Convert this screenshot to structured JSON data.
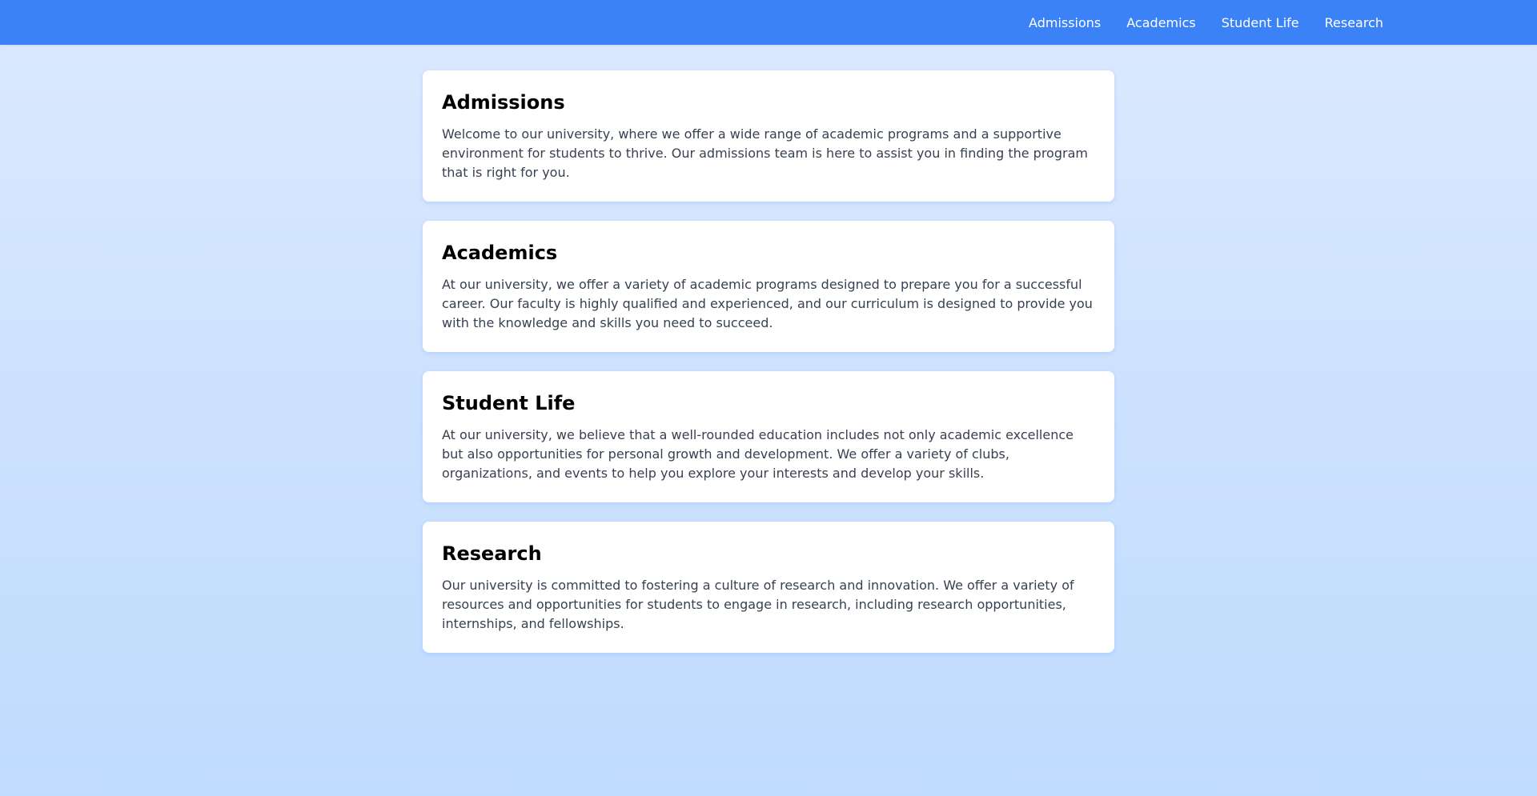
{
  "nav": {
    "items": [
      {
        "label": "Admissions"
      },
      {
        "label": "Academics"
      },
      {
        "label": "Student Life"
      },
      {
        "label": "Research"
      }
    ]
  },
  "sections": [
    {
      "title": "Admissions",
      "text": "Welcome to our university, where we offer a wide range of academic programs and a supportive environment for students to thrive. Our admissions team is here to assist you in finding the program that is right for you."
    },
    {
      "title": "Academics",
      "text": "At our university, we offer a variety of academic programs designed to prepare you for a successful career. Our faculty is highly qualified and experienced, and our curriculum is designed to provide you with the knowledge and skills you need to succeed."
    },
    {
      "title": "Student Life",
      "text": "At our university, we believe that a well-rounded education includes not only academic excellence but also opportunities for personal growth and development. We offer a variety of clubs, organizations, and events to help you explore your interests and develop your skills."
    },
    {
      "title": "Research",
      "text": "Our university is committed to fostering a culture of research and innovation. We offer a variety of resources and opportunities for students to engage in research, including research opportunities, internships, and fellowships."
    }
  ],
  "colors": {
    "header": "#3b82f6",
    "background_top": "#dbe9fe",
    "background_bottom": "#bfdbfe",
    "card": "#ffffff",
    "body_text": "#374151"
  }
}
